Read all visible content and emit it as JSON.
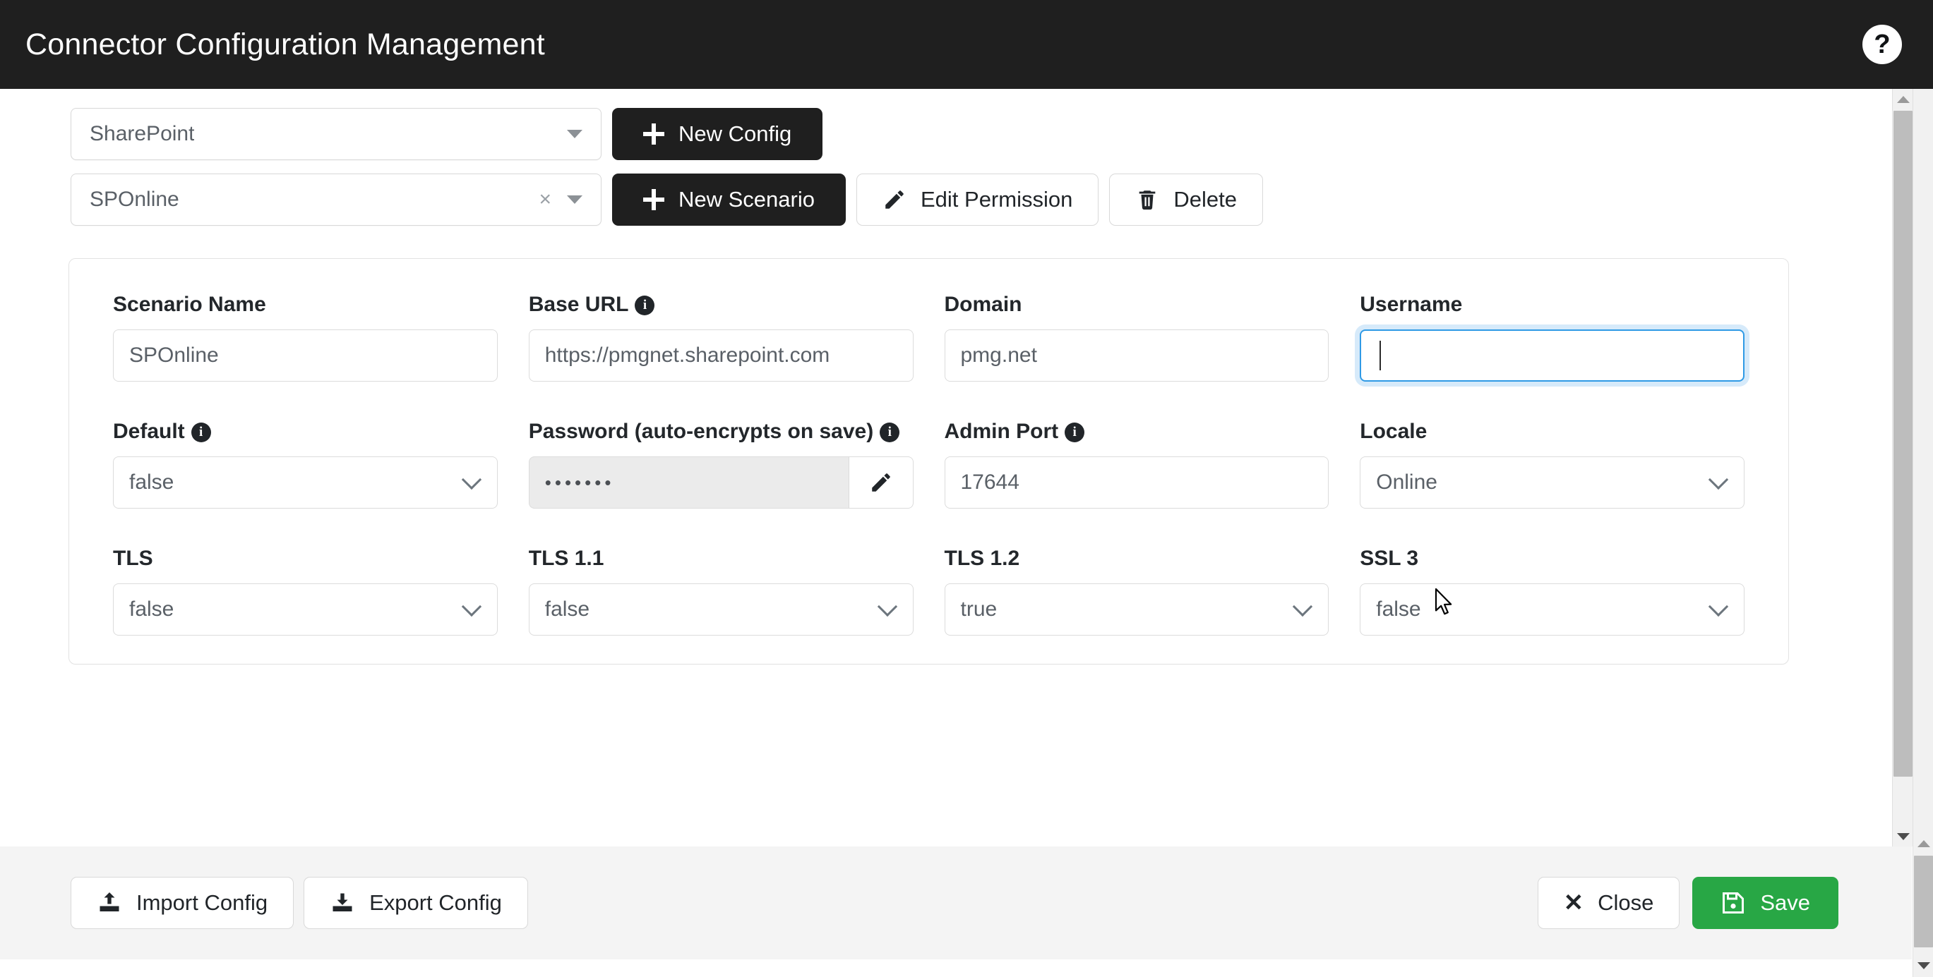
{
  "header": {
    "title": "Connector Configuration Management",
    "help_label": "?"
  },
  "toolbar": {
    "connector_select": {
      "value": "SharePoint"
    },
    "new_config_label": "New Config",
    "scenario_select": {
      "value": "SPOnline",
      "clear_label": "×"
    },
    "new_scenario_label": "New Scenario",
    "edit_permission_label": "Edit Permission",
    "delete_label": "Delete"
  },
  "form": {
    "fields": [
      {
        "label": "Scenario Name",
        "info": false,
        "type": "text",
        "value": "SPOnline"
      },
      {
        "label": "Base URL",
        "info": true,
        "type": "text",
        "value": "https://pmgnet.sharepoint.com"
      },
      {
        "label": "Domain",
        "info": false,
        "type": "text",
        "value": "pmg.net"
      },
      {
        "label": "Username",
        "info": false,
        "type": "text",
        "value": "",
        "focused": true
      },
      {
        "label": "Default",
        "info": true,
        "type": "select",
        "value": "false"
      },
      {
        "label": "Password (auto-encrypts on save)",
        "info": true,
        "type": "password",
        "value": "•••••••"
      },
      {
        "label": "Admin Port",
        "info": true,
        "type": "text",
        "value": "17644"
      },
      {
        "label": "Locale",
        "info": false,
        "type": "select",
        "value": "Online"
      },
      {
        "label": "TLS",
        "info": false,
        "type": "select",
        "value": "false"
      },
      {
        "label": "TLS 1.1",
        "info": false,
        "type": "select",
        "value": "false"
      },
      {
        "label": "TLS 1.2",
        "info": false,
        "type": "select",
        "value": "true"
      },
      {
        "label": "SSL 3",
        "info": false,
        "type": "select",
        "value": "false"
      }
    ],
    "info_glyph": "i"
  },
  "footer": {
    "import_label": "Import Config",
    "export_label": "Export Config",
    "close_label": "Close",
    "close_glyph": "✕",
    "save_label": "Save"
  },
  "colors": {
    "header_bg": "#1f1f1f",
    "accent_dark": "#1f1f1f",
    "save_green": "#28a745",
    "focus_blue": "#2f9ae5",
    "footer_bg": "#f4f4f4"
  }
}
